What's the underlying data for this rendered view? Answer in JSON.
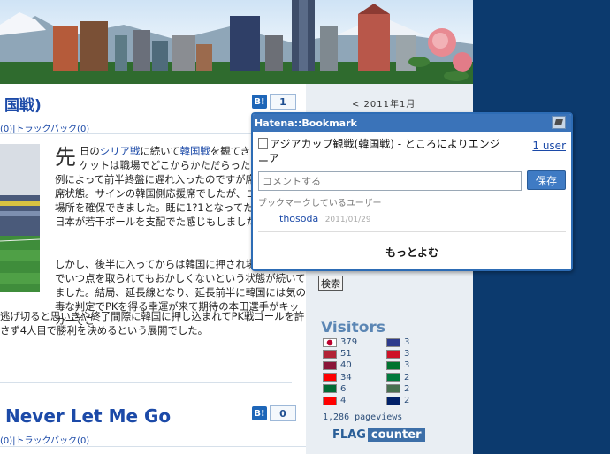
{
  "post1": {
    "title_fragment": "国戦)",
    "bookmark_label": "B!",
    "bookmark_count": "1",
    "meta_comments": "(0)",
    "meta_sep": "|",
    "meta_trackback": "トラックバック(0)",
    "dropcap": "先",
    "para1_a": "日の",
    "para1_link1": "シリア戦",
    "para1_b": "に続いて",
    "para1_link2": "韓国戦",
    "para1_c": "を観てきました。チケットは職場でどこからかただらったのですが、例によって前半終盤に遅れ入ったのですが席は既に自由席状態。サインの韓国側応援席でしたが、ゴール横の場所を確保できました。既に1?1となってたが、前半は日本が若干ボールを支配でた感じもしました。",
    "para2": "しかし、後半に入ってからは韓国に押され場面ばかりでいつ点を取られてもおかしくないという状態が続いてました。結局、延長線となり、延長前半に韓国には気の毒な判定でPKを得る幸運が来て期待の本田選手がキッカーでこ",
    "para3": "逃げ切ると思いきや終了間際に韓国に押し込まれてPK戦ゴールを許さず4人目で勝利を決めるという展開でした。"
  },
  "post2": {
    "title": "Never Let Me Go",
    "bookmark_label": "B!",
    "bookmark_count": "0",
    "meta_comments": "(0)",
    "meta_sep": "|",
    "meta_trackback": "トラックバック(0)"
  },
  "sidebar": {
    "calendar_title": "< 2011年1月",
    "search_button": "検索",
    "visitors_title": "Visitors",
    "flags": [
      {
        "country": "Japan",
        "count": "379",
        "color": "#ffffff"
      },
      {
        "country": "Thailand",
        "count": "3",
        "color": "#2d3a8c"
      },
      {
        "country": "United States",
        "count": "51",
        "color": "#b22234"
      },
      {
        "country": "Bahrain",
        "count": "3",
        "color": "#ce1126"
      },
      {
        "country": "Qatar",
        "count": "40",
        "color": "#8a1538"
      },
      {
        "country": "United Arab Emirates",
        "count": "3",
        "color": "#00732f"
      },
      {
        "country": "Taiwan",
        "count": "34",
        "color": "#fe0000"
      },
      {
        "country": "Kuwait",
        "count": "2",
        "color": "#007a3d"
      },
      {
        "country": "Saudi Arabia",
        "count": "6",
        "color": "#006c35"
      },
      {
        "country": "Hungary",
        "count": "2",
        "color": "#477050"
      },
      {
        "country": "Canada",
        "count": "4",
        "color": "#ff0000"
      },
      {
        "country": "United Kingdom",
        "count": "2",
        "color": "#012169"
      }
    ],
    "pageviews": "1,286 pageviews",
    "flagcounter_flag": "FLAG",
    "flagcounter_counter": "counter"
  },
  "popup": {
    "header": "Hatena::Bookmark",
    "entry_title": "アジアカップ観戦(韓国戦) - ところによりエンジニア",
    "users_link": "1 user",
    "comment_placeholder": "コメントする",
    "save_button": "保存",
    "section_label": "ブックマークしているユーザー",
    "user_name": "thosoda",
    "user_date": "2011/01/29",
    "more_link": "もっとよむ"
  },
  "colors": {
    "accent": "#1c4aa8",
    "popup_header": "#3a73b9",
    "page_bg": "#0c3a6e"
  }
}
